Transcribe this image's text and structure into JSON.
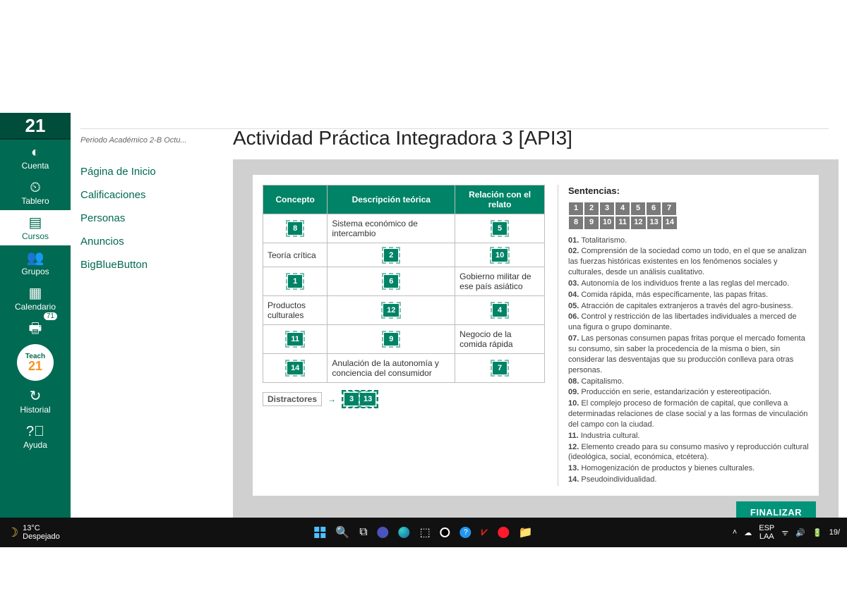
{
  "logo": "21",
  "global_nav": {
    "cuenta": "Cuenta",
    "tablero": "Tablero",
    "cursos": "Cursos",
    "grupos": "Grupos",
    "calendario": "Calendario",
    "inbox_badge": "71",
    "teach": "Teach",
    "teach_num": "21",
    "historial": "Historial",
    "ayuda": "Ayuda"
  },
  "course_nav": {
    "breadcrumb": "Periodo Académico 2-B Octu...",
    "items": [
      "Página de Inicio",
      "Calificaciones",
      "Personas",
      "Anuncios",
      "BigBlueButton"
    ]
  },
  "page_title": "Actividad Práctica Integradora 3 [API3]",
  "table": {
    "headers": [
      "Concepto",
      "Descripción teórica",
      "Relación con el relato"
    ],
    "rows": [
      {
        "c": "",
        "c_chip": "8",
        "d": "Sistema económico de intercambio",
        "d_chip": "",
        "r": "",
        "r_chip": "5"
      },
      {
        "c": "Teoría crítica",
        "c_chip": "",
        "d": "",
        "d_chip": "2",
        "r": "",
        "r_chip": "10"
      },
      {
        "c": "",
        "c_chip": "1",
        "d": "",
        "d_chip": "6",
        "r": "Gobierno militar de ese país asiático",
        "r_chip": ""
      },
      {
        "c": "Productos culturales",
        "c_chip": "",
        "d": "",
        "d_chip": "12",
        "r": "",
        "r_chip": "4"
      },
      {
        "c": "",
        "c_chip": "11",
        "d": "",
        "d_chip": "9",
        "r": "Negocio de la comida rápida",
        "r_chip": ""
      },
      {
        "c": "",
        "c_chip": "14",
        "d": "Anulación de la autonomía y conciencia del consumidor",
        "d_chip": "",
        "r": "",
        "r_chip": "7"
      }
    ]
  },
  "distractors": {
    "label": "Distractores",
    "chips": [
      "3",
      "13"
    ]
  },
  "sentences": {
    "title": "Sentencias:",
    "nums_row1": [
      "1",
      "2",
      "3",
      "4",
      "5",
      "6",
      "7"
    ],
    "nums_row2": [
      "8",
      "9",
      "10",
      "11",
      "12",
      "13",
      "14"
    ],
    "items": [
      "01.  Totalitarismo.",
      "02.  Comprensión de la sociedad como un todo, en el que se analizan las fuerzas históricas existentes en los fenómenos sociales y culturales, desde un análisis cualitativo.",
      "03.  Autonomía de los individuos frente a las reglas del mercado.",
      "04.  Comida rápida, más específicamente, las papas fritas.",
      "05.  Atracción de capitales extranjeros a través del agro-business.",
      "06.  Control y restricción de las libertades individuales a merced de una figura o grupo dominante.",
      "07.  Las personas consumen papas fritas porque el mercado fomenta su consumo, sin saber la procedencia de la misma o bien, sin considerar las desventajas que su producción conlleva para otras personas.",
      "08.  Capitalismo.",
      "09.  Producción en serie, estandarización y estereotipación.",
      "10.  El complejo proceso de formación de capital, que conlleva a determinadas relaciones de clase social y a las formas de vinculación del campo con la ciudad.",
      "11.  Industria cultural.",
      "12.  Elemento creado para su consumo masivo y reproducción cultural (ideológica, social, económica, etcétera).",
      "13.  Homogenización de productos y bienes culturales.",
      "14.  Pseudoindividualidad."
    ]
  },
  "finalize": "FINALIZAR",
  "taskbar": {
    "temp": "13°C",
    "weather": "Despejado",
    "lang1": "ESP",
    "lang2": "LAA",
    "time_suffix": "19/"
  }
}
